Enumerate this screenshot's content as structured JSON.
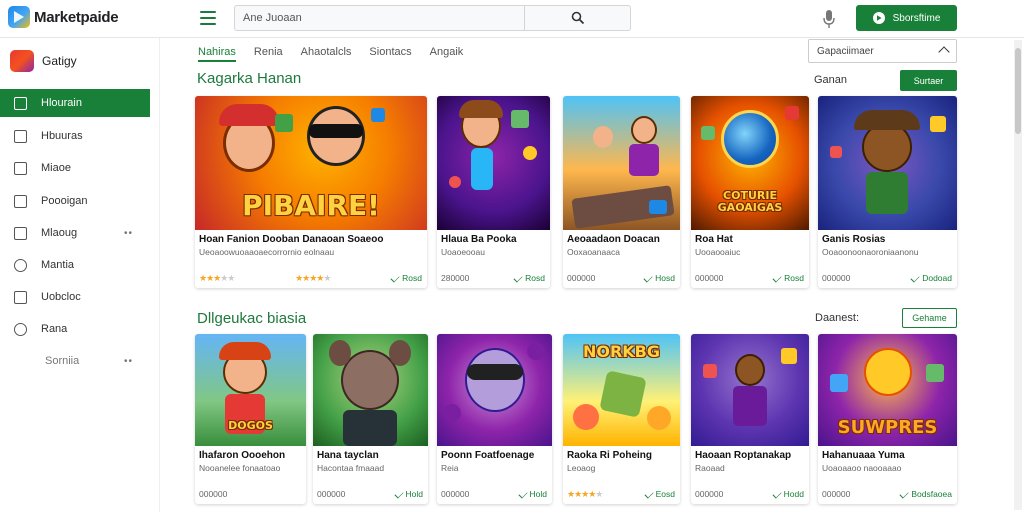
{
  "app": {
    "title": "Marketpaide"
  },
  "search": {
    "placeholder": "Ane Juoaan"
  },
  "header": {
    "cta_label": "Sborsftime"
  },
  "sidebar": {
    "category_label": "Gatigy",
    "items": [
      {
        "label": "Hlourain",
        "active": true
      },
      {
        "label": "Hbuuras"
      },
      {
        "label": "Miaoe"
      },
      {
        "label": "Poooigan"
      },
      {
        "label": "Mlaoug",
        "dots": "••"
      },
      {
        "label": "Mantia"
      },
      {
        "label": "Uobcloc"
      },
      {
        "label": "Rana"
      },
      {
        "label": "Sorniia",
        "dots": "••"
      }
    ]
  },
  "tabs": [
    "Nahiras",
    "Renia",
    "Ahaotalcls",
    "Siontacs",
    "Angaik"
  ],
  "sort": {
    "value": "Gapaciimaer"
  },
  "sections": [
    {
      "title": "Kagarka Hanan",
      "extra": "Ganan",
      "button": "Surtaer",
      "cards": [
        {
          "title": "Hoan Fanion Dooban Danaoan Soaeoo",
          "sub": "Ueoaoowuoaaoaecorrornio eolnaau",
          "rating": 3,
          "meta": "",
          "action": "",
          "thumb_text": "PIBAIRE!"
        },
        {
          "title": "",
          "sub": "",
          "rating": 4,
          "meta": "",
          "action": "Rosd",
          "thumb_text": ""
        },
        {
          "title": "Hlaua Ba Pooka",
          "sub": "Uoaoeooau",
          "rating": 0,
          "meta": "280000",
          "action": "Rosd",
          "thumb_text": ""
        },
        {
          "title": "Aeoaadaon Doacan",
          "sub": "Ooxaoanaaca",
          "rating": 0,
          "meta": "000000",
          "action": "Hosd",
          "thumb_text": ""
        },
        {
          "title": "Roa Hat",
          "sub": "Uooaooaiuc",
          "rating": 0,
          "meta": "000000",
          "action": "Rosd",
          "thumb_text": "COTURIE GAOAIGAS"
        },
        {
          "title": "Ganis Rosias",
          "sub": "Ooaoonoonaoroniaanonu",
          "rating": 0,
          "meta": "000000",
          "action": "Dodoad",
          "thumb_text": ""
        }
      ]
    },
    {
      "title": "Dllgeukac biasia",
      "extra": "Daanest:",
      "button": "Gehame",
      "cards": [
        {
          "title": "Ihafaron Oooehon",
          "sub": "Nooanelee fonaatoao",
          "rating": 0,
          "meta": "000000",
          "action": "",
          "thumb_text": "DOGOS"
        },
        {
          "title": "Hana tayclan",
          "sub": "Hacontaa fmaaad",
          "rating": 0,
          "meta": "000000",
          "action": "Hold",
          "thumb_text": ""
        },
        {
          "title": "Poonn Foatfoenage",
          "sub": "Reia",
          "rating": 0,
          "meta": "000000",
          "action": "Hold",
          "thumb_text": ""
        },
        {
          "title": "Raoka Ri Poheing",
          "sub": "Leoaog",
          "rating": 4,
          "meta": "",
          "action": "Eosd",
          "thumb_text": "NORKBG"
        },
        {
          "title": "Haoaan Roptanakap",
          "sub": "Raoaad",
          "rating": 0,
          "meta": "000000",
          "action": "Hodd",
          "thumb_text": ""
        },
        {
          "title": "Hahanuaaa Yuma",
          "sub": "Uoaoaaoo naooaaao",
          "rating": 0,
          "meta": "000000",
          "action": "Bodsfaoea",
          "thumb_text": "SUWPRES"
        }
      ]
    }
  ]
}
